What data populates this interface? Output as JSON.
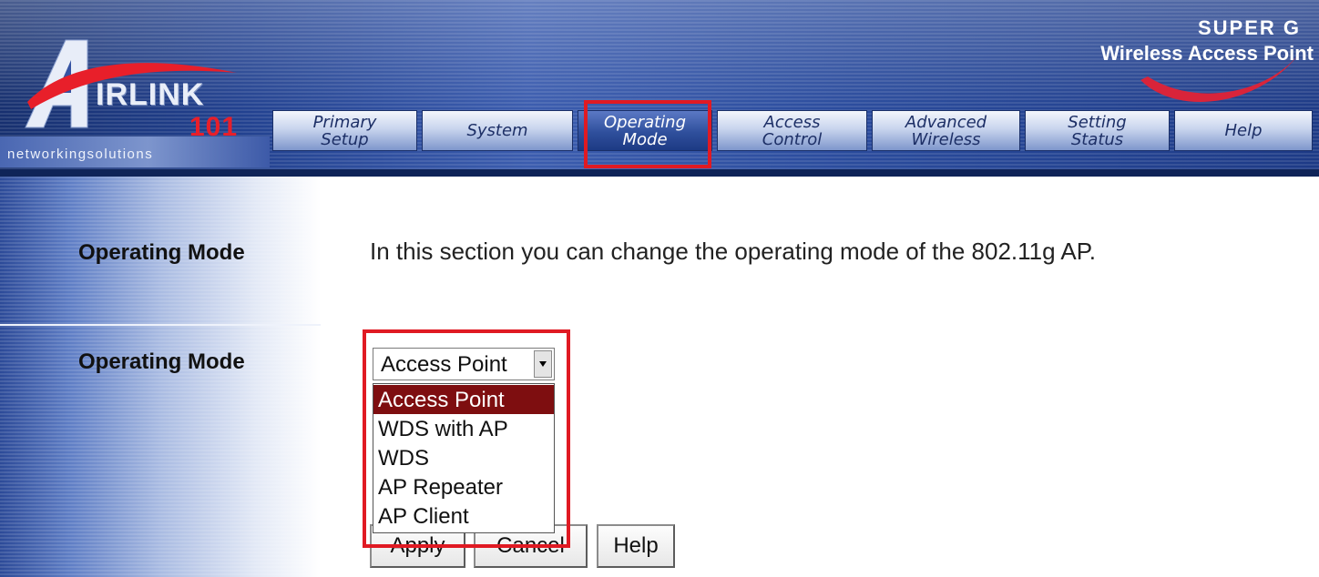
{
  "brand": {
    "logo_first_letter": "A",
    "logo_word": "IRLINK",
    "logo_number": "101",
    "tagline": "networkingsolutions"
  },
  "product": {
    "line1": "SUPER G",
    "line2": "Wireless Access Point"
  },
  "nav": {
    "tabs": [
      {
        "label": "Primary\nSetup",
        "active": false
      },
      {
        "label": "System",
        "active": false
      },
      {
        "label": "Operating\nMode",
        "active": true
      },
      {
        "label": "Access\nControl",
        "active": false
      },
      {
        "label": "Advanced\nWireless",
        "active": false
      },
      {
        "label": "Setting\nStatus",
        "active": false
      },
      {
        "label": "Help",
        "active": false
      }
    ]
  },
  "sidebar": {
    "section_title": "Operating Mode",
    "field_label": "Operating Mode"
  },
  "main": {
    "description": "In this section you can change the operating mode of the 802.11g AP.",
    "mode_select": {
      "value": "Access Point",
      "options": [
        "Access Point",
        "WDS with AP",
        "WDS",
        "AP Repeater",
        "AP Client"
      ],
      "selected_index": 0
    },
    "buttons": {
      "apply": "Apply",
      "cancel": "Cancel",
      "help": "Help"
    }
  },
  "colors": {
    "highlight": "#e01a23",
    "selected_option_bg": "#7e0e10",
    "brand_red": "#e81f2a"
  },
  "icons": {
    "select_arrow": "chevron-down-icon"
  }
}
